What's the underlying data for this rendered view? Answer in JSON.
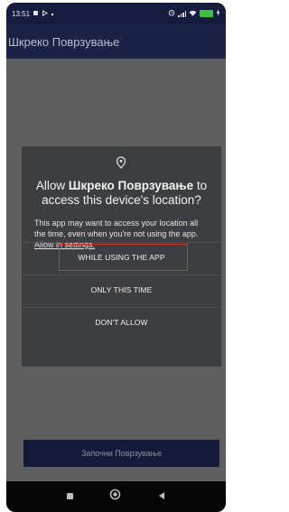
{
  "status_bar": {
    "time": "13:51",
    "left_icons": [
      "notification-icon",
      "play-icon",
      "dot-icon"
    ],
    "right_icons": [
      "alarm-icon",
      "signal-icon",
      "wifi-icon",
      "battery-icon"
    ],
    "battery_label": "100"
  },
  "app_bar": {
    "title": "Шкреко Поврзување"
  },
  "dialog": {
    "title_prefix": "Allow ",
    "title_app": "Шкреко Поврзување",
    "title_suffix": " to access this device's location?",
    "body_text": "This app may want to access your location all the time, even when you're not using the app.",
    "body_link": "Allow in settings.",
    "options": [
      "WHILE USING THE APP",
      "ONLY THIS TIME",
      "DON'T ALLOW"
    ]
  },
  "main": {
    "start_button_label": "Започни Поврзување"
  },
  "nav_bar": {
    "icons": [
      "recents-icon",
      "home-icon",
      "back-icon"
    ]
  },
  "colors": {
    "status_bar": "#151c3e",
    "app_bar": "#1a2346",
    "scrim": "#5f5f5f",
    "dialog": "#3c3f41",
    "highlight": "#d0322e"
  }
}
